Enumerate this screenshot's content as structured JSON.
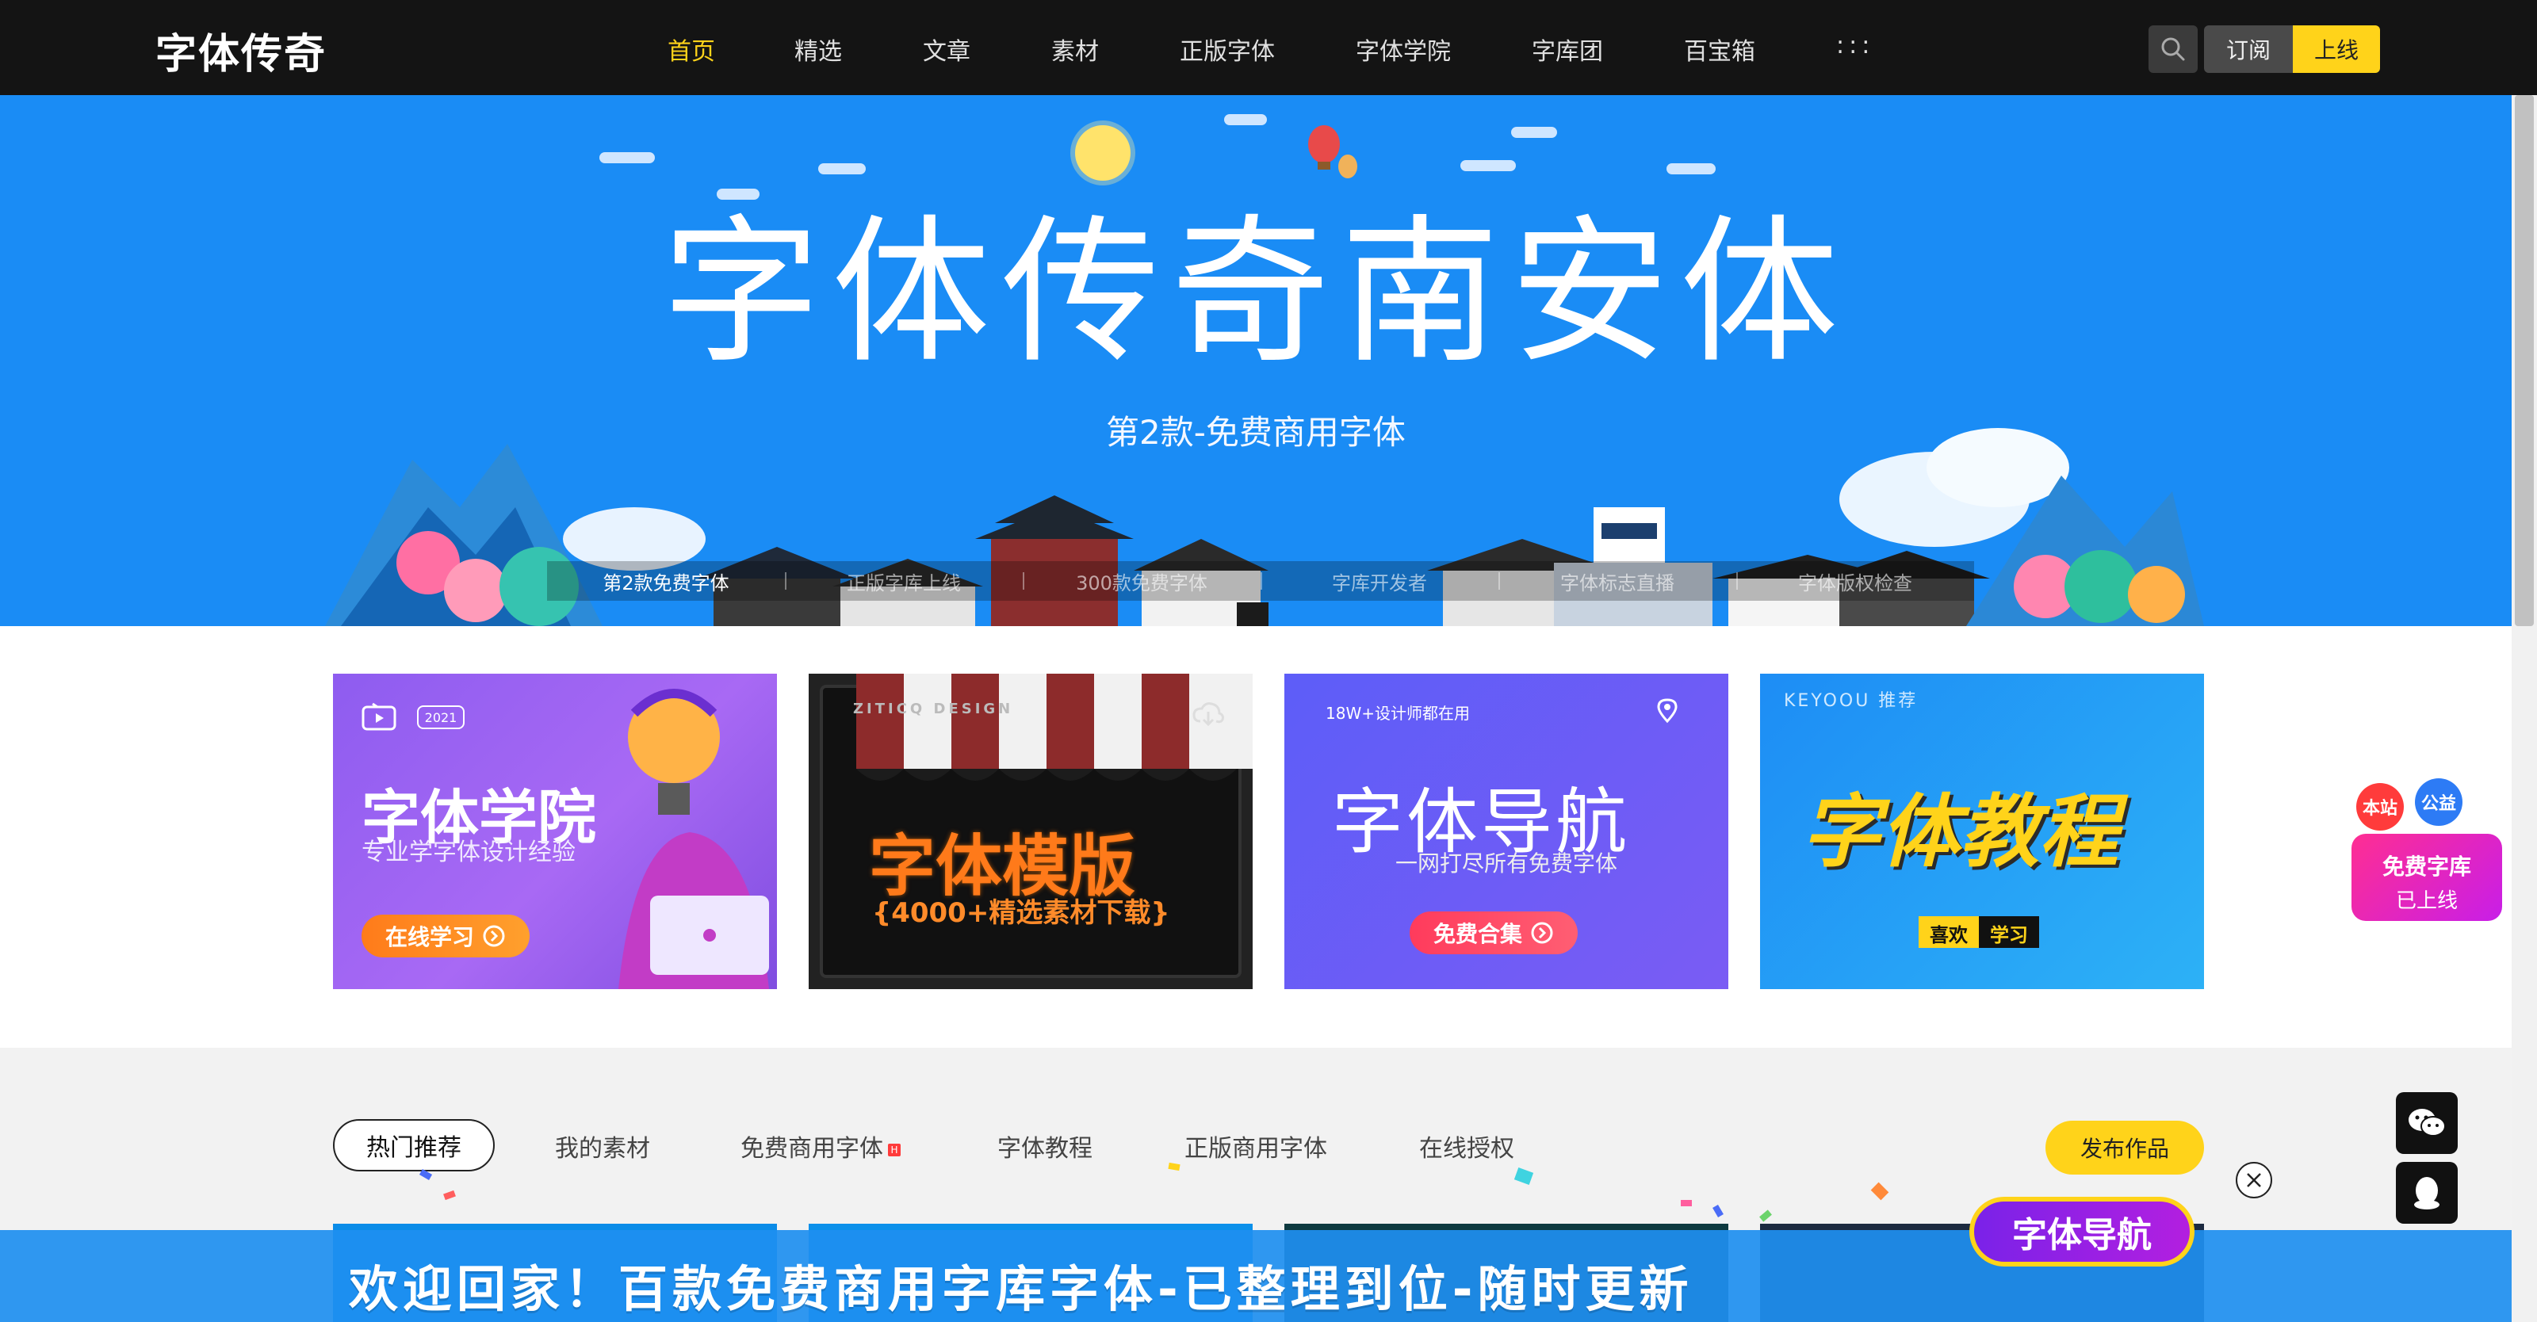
{
  "header": {
    "logo_text": "字体传奇",
    "nav": [
      "首页",
      "精选",
      "文章",
      "素材",
      "正版字体",
      "字体学院",
      "字库团",
      "百宝箱",
      ":::"
    ],
    "subscribe_label": "订阅",
    "online_label": "上线"
  },
  "hero": {
    "title": "字体传奇南安体",
    "subtitle": "第2款-免费商用字体",
    "tabs": [
      "第2款免费字体",
      "正版字库上线",
      "300款免费字体",
      "字库开发者",
      "字体标志直播",
      "字体版权检查"
    ]
  },
  "cards": [
    {
      "badge": "2021",
      "title": "字体学院",
      "subtitle": "专业学字体设计经验",
      "button": "在线学习"
    },
    {
      "brand": "ZITICQ DESIGN",
      "title": "字体模版",
      "subtitle": "{4000+精选素材下载}"
    },
    {
      "top_note": "18W+设计师都在用",
      "title": "字体导航",
      "subtitle": "一网打尽所有免费字体",
      "button": "免费合集"
    },
    {
      "brand": "KEYOOU 推荐",
      "title": "字体教程",
      "tag_left": "喜欢",
      "tag_right": "学习"
    }
  ],
  "section2": {
    "tabs": [
      "热门推荐",
      "我的素材",
      "免费商用字体",
      "字体教程",
      "正版商用字体",
      "在线授权"
    ],
    "hot_badge": "H",
    "publish_label": "发布作品"
  },
  "bottom": {
    "banner_text": "欢迎回家！百款免费商用字库字体-已整理到位-随时更新",
    "badge_text": "字体导航"
  },
  "floating": {
    "bubble_left": "本站",
    "bubble_right": "公益",
    "free_lib_line1": "免费字库",
    "free_lib_line2": "已上线"
  },
  "colors": {
    "accent": "#ffd31a",
    "hero_bg": "#1a8cf5",
    "topbar_bg": "#141414"
  },
  "icons": [
    "search-icon",
    "wechat-icon",
    "qq-icon",
    "close-icon",
    "arrow-right-icon"
  ]
}
